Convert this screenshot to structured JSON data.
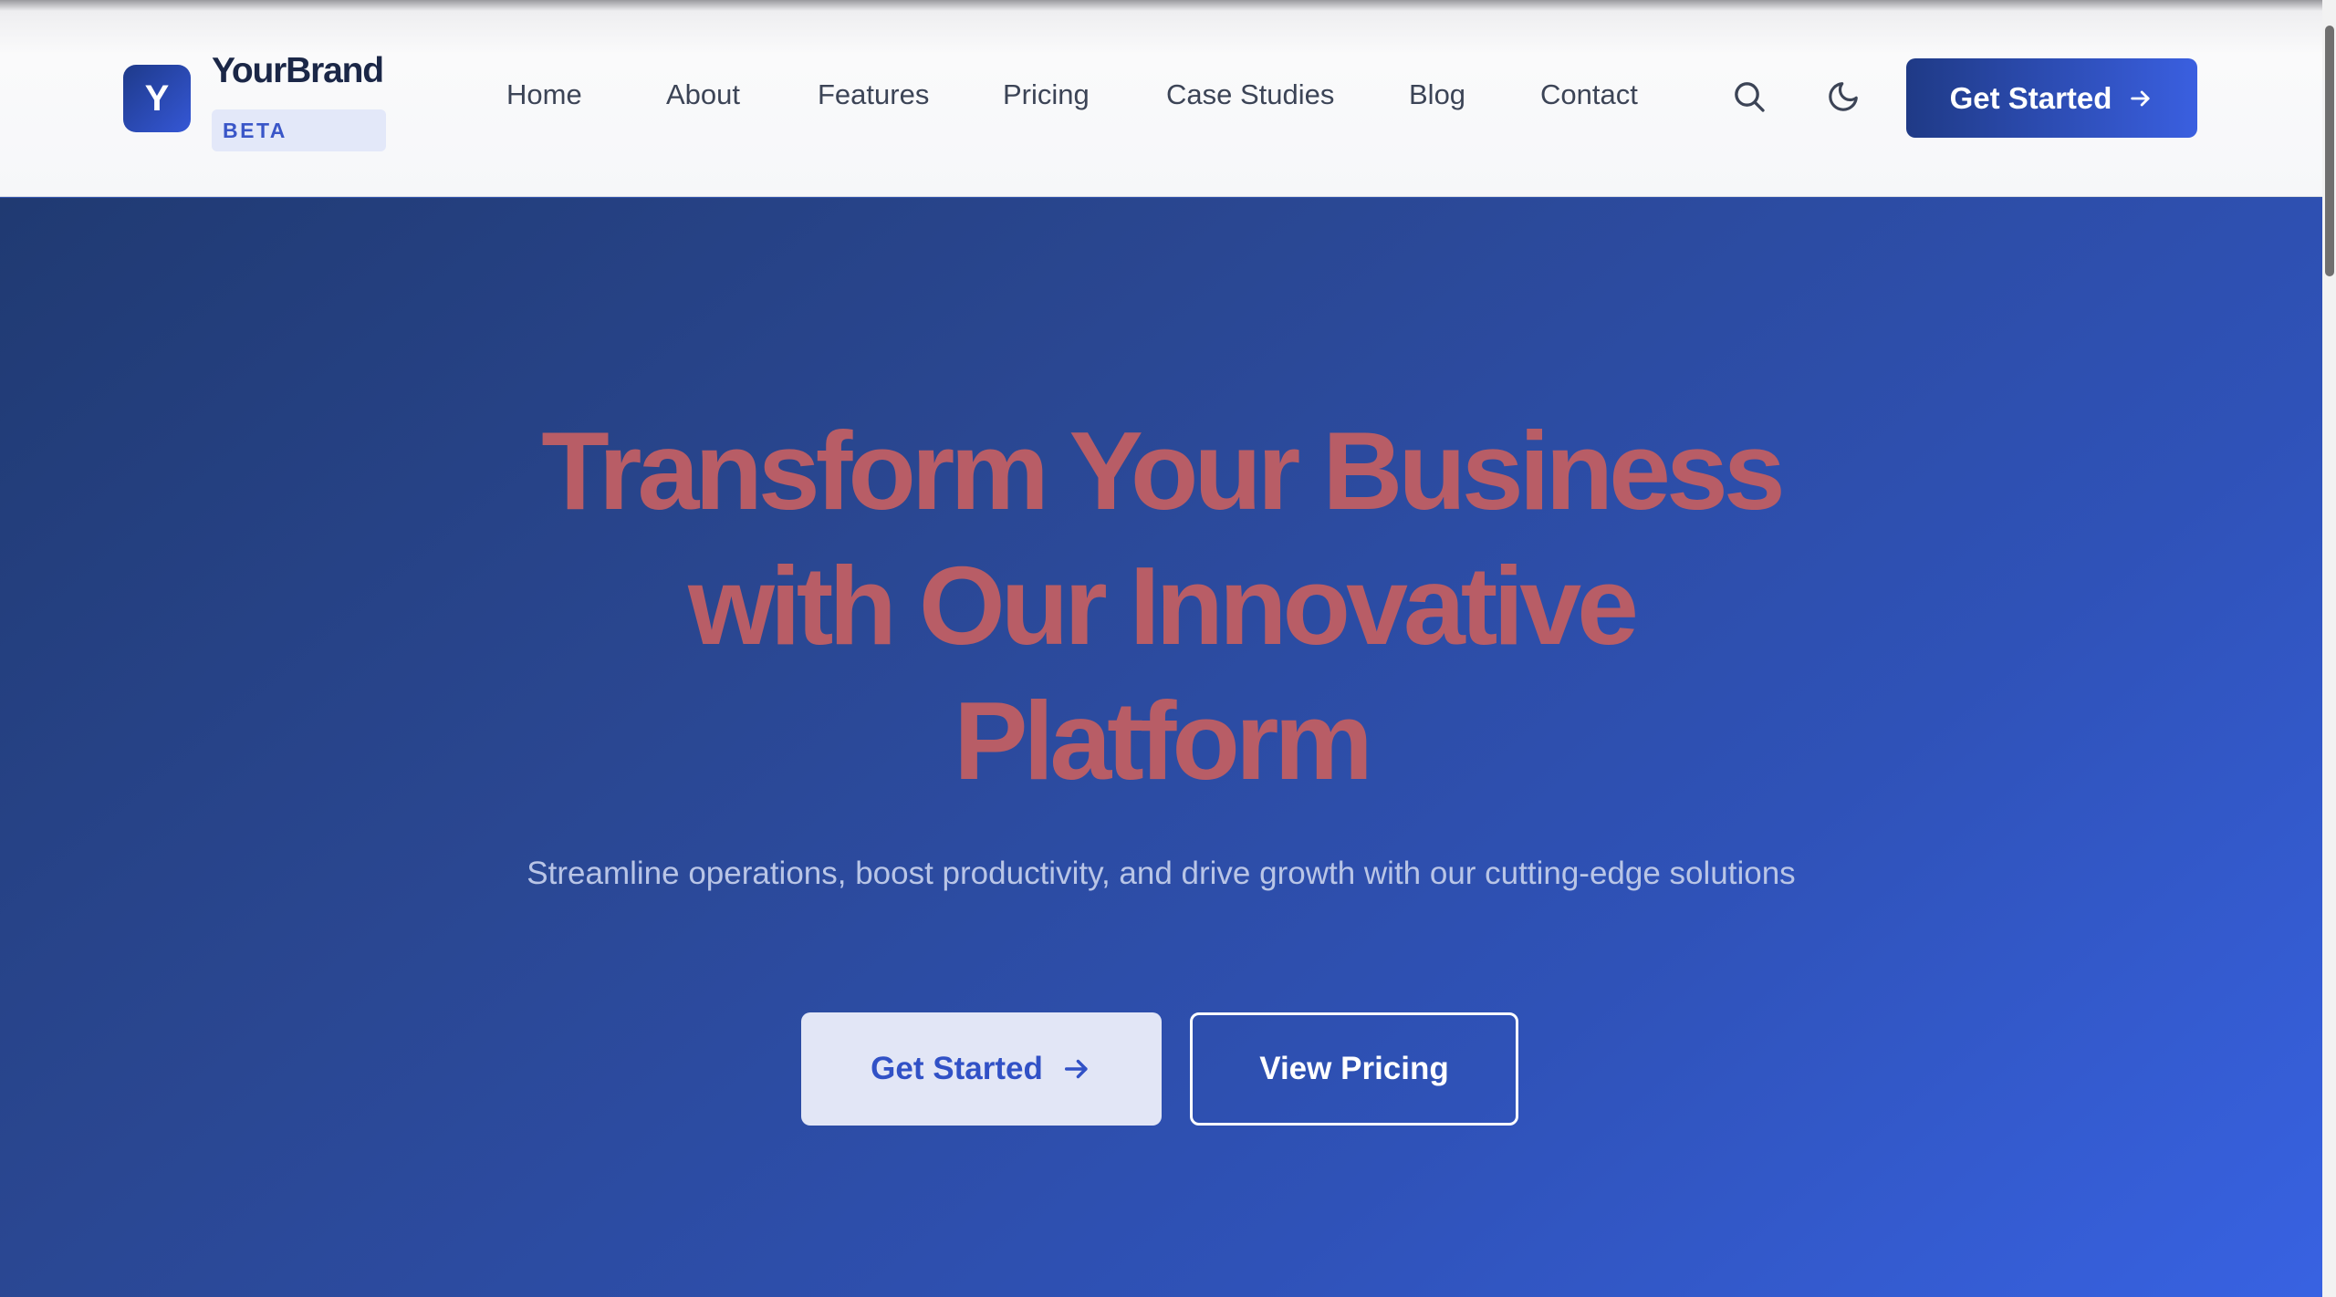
{
  "header": {
    "logo_letter": "Y",
    "brand_name": "YourBrand",
    "badge": "BETA",
    "nav": [
      {
        "label": "Home"
      },
      {
        "label": "About"
      },
      {
        "label": "Features"
      },
      {
        "label": "Pricing"
      },
      {
        "label": "Case Studies"
      },
      {
        "label": "Blog"
      },
      {
        "label": "Contact"
      }
    ],
    "search_icon": "search-icon",
    "theme_icon": "moon-icon",
    "cta_label": "Get Started"
  },
  "hero": {
    "title_line1": "Transform Your Business",
    "title_line2": "with Our Innovative",
    "title_line3": "Platform",
    "subtitle": "Streamline operations, boost productivity, and drive growth with our cutting-edge solutions",
    "primary_button": "Get Started",
    "secondary_button": "View Pricing"
  },
  "colors": {
    "brand_dark": "#1e3a8a",
    "brand_accent": "#3a5fe0",
    "title_color": "#b85d66",
    "badge_bg": "#e3e8f9"
  }
}
